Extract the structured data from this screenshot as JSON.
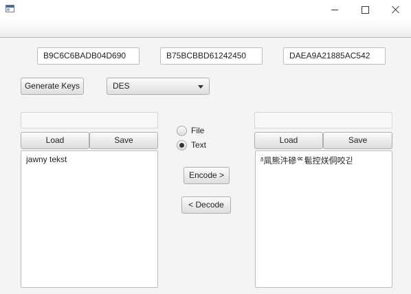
{
  "window": {
    "title": ""
  },
  "keys": {
    "key1": "B9C6C6BADB04D690",
    "key2": "B75BCBBD61242450",
    "key3": "DAEA9A21885AC542"
  },
  "controls": {
    "generate_keys_label": "Generate Keys",
    "algorithm_selected": "DES"
  },
  "left_panel": {
    "file_path": "",
    "load_label": "Load",
    "save_label": "Save",
    "text": "jawny tekst"
  },
  "right_panel": {
    "file_path": "",
    "load_label": "Load",
    "save_label": "Save",
    "text": "ᵟ凬熊汼磣ᅂ髱控烪侗咬긷"
  },
  "mode": {
    "file_label": "File",
    "text_label": "Text",
    "selected": "text"
  },
  "actions": {
    "encode_label": "Encode >",
    "decode_label": "< Decode"
  }
}
